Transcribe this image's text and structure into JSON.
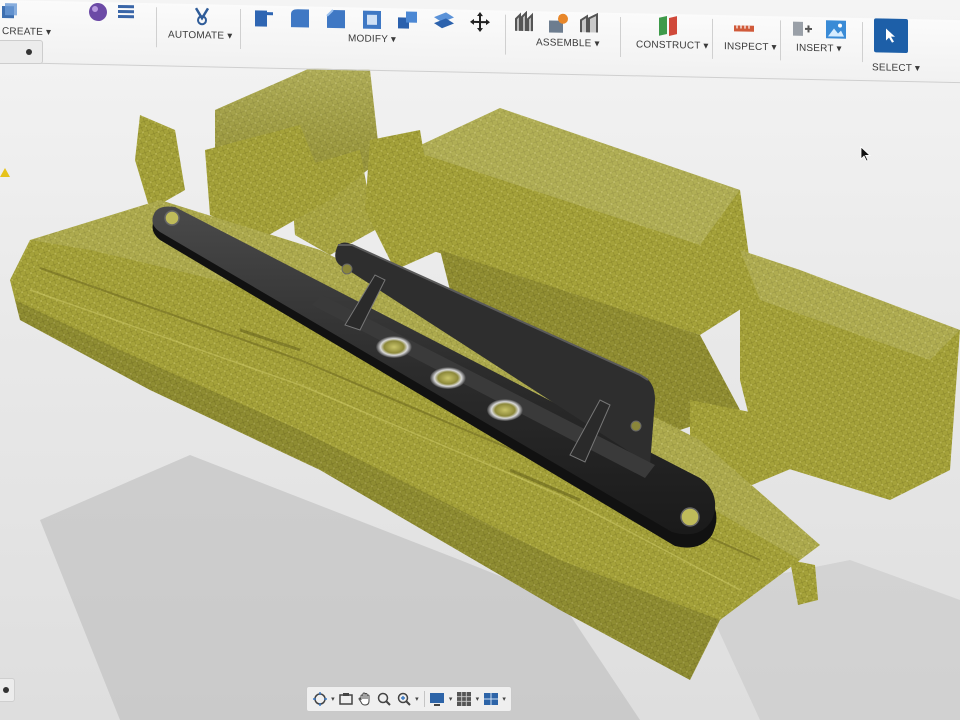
{
  "toolbar": {
    "groups": [
      {
        "id": "create",
        "label": "CREATE",
        "icons": [
          "extrude-icon",
          "sphere-icon",
          "coil-icon"
        ]
      },
      {
        "id": "automate",
        "label": "AUTOMATE",
        "icons": [
          "automate-icon"
        ]
      },
      {
        "id": "modify",
        "label": "MODIFY",
        "icons": [
          "press-pull-icon",
          "fillet-icon",
          "chamfer-icon",
          "shell-icon",
          "combine-icon",
          "offset-face-icon",
          "move-icon"
        ]
      },
      {
        "id": "assemble",
        "label": "ASSEMBLE",
        "icons": [
          "new-component-icon",
          "joint-icon",
          "as-built-joint-icon"
        ]
      },
      {
        "id": "construct",
        "label": "CONSTRUCT",
        "icons": [
          "offset-plane-icon"
        ]
      },
      {
        "id": "inspect",
        "label": "INSPECT",
        "icons": [
          "measure-icon"
        ]
      },
      {
        "id": "insert",
        "label": "INSERT",
        "icons": [
          "insert-derive-icon",
          "insert-image-icon"
        ]
      },
      {
        "id": "select",
        "label": "SELECT",
        "icons": [
          "select-arrow-icon"
        ]
      }
    ],
    "caret": "▾"
  },
  "navbar": {
    "items": [
      "orbit-icon",
      "look-at-icon",
      "pan-icon",
      "zoom-icon",
      "fit-icon",
      "display-settings-icon",
      "grid-icon",
      "viewports-icon"
    ]
  },
  "colors": {
    "scan_mesh": "#a8a43a",
    "bracket": "#2f2f2f",
    "select_accent": "#1d5fa8"
  }
}
